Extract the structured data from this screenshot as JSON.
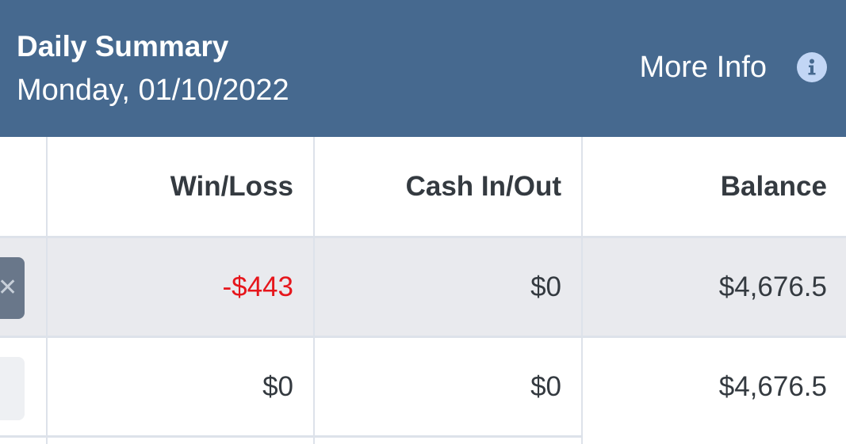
{
  "header": {
    "title": "Daily Summary",
    "date": "Monday, 01/10/2022",
    "more_info_label": "More Info"
  },
  "table": {
    "columns": [
      "Win/Loss",
      "Cash In/Out",
      "Balance"
    ],
    "rows": [
      {
        "win_loss": "-$443",
        "cash": "$0",
        "balance": "$4,676.5",
        "win_loss_color": "#e6161c"
      },
      {
        "win_loss": "$0",
        "cash": "$0",
        "balance": "$4,676.5"
      }
    ]
  },
  "icons": {
    "info": "info-icon",
    "close": "close-icon"
  },
  "colors": {
    "header_bg": "#46698f",
    "negative": "#e6161c",
    "shaded_row": "#e9eaee",
    "info_icon_bg": "#c2d6f5"
  }
}
